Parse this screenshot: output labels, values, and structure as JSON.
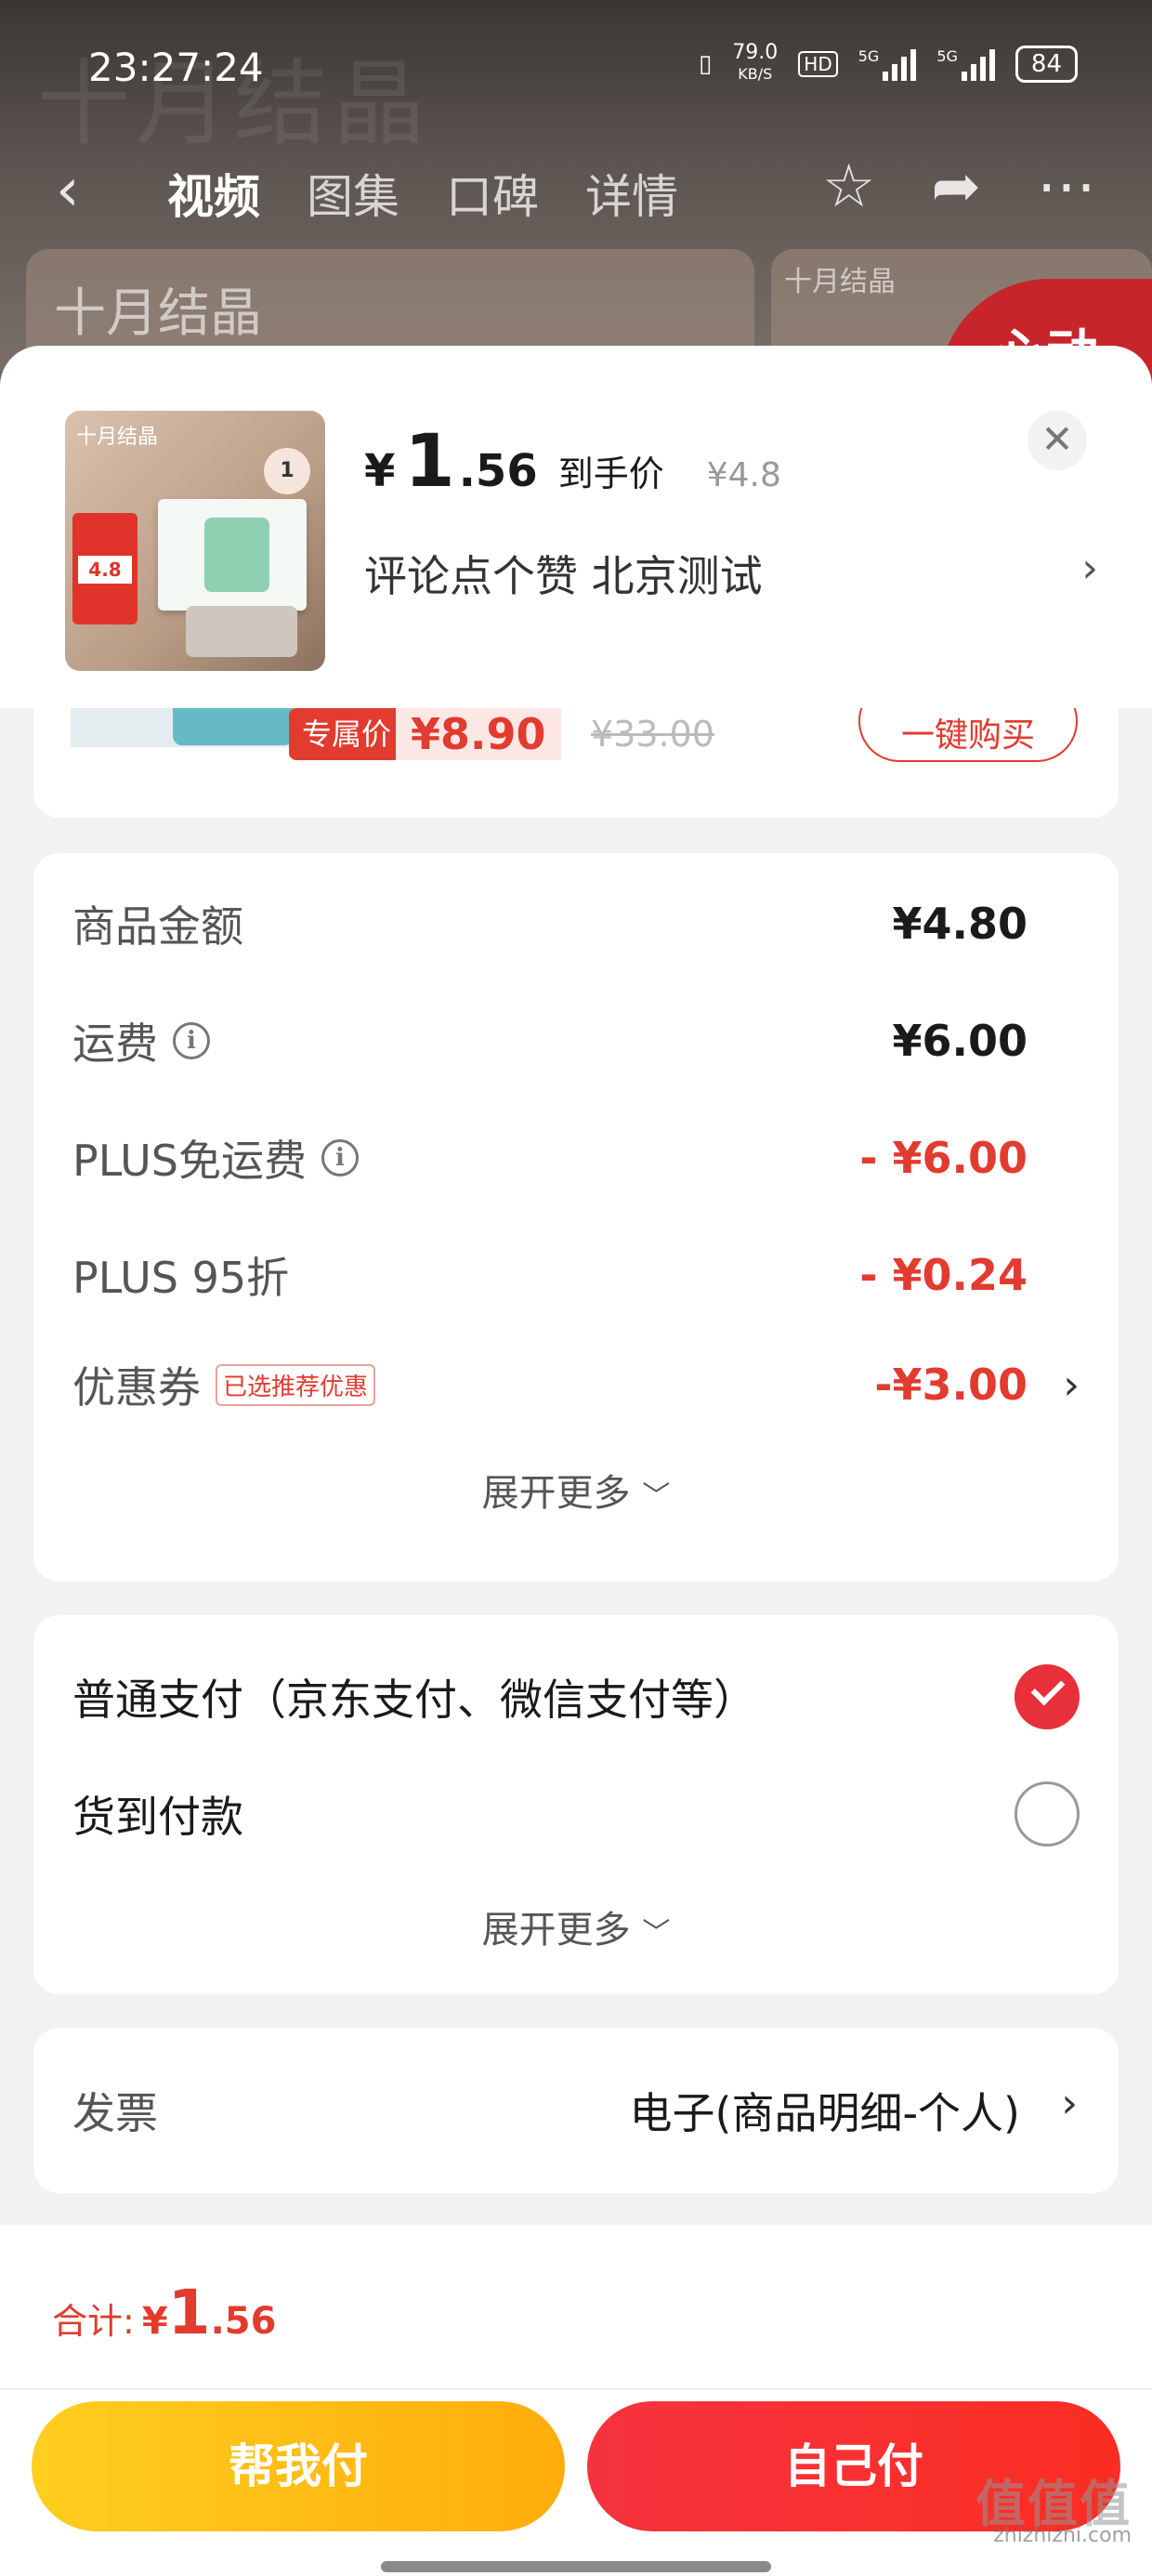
{
  "status_bar": {
    "time": "23:27:24",
    "network_speed": "79.0",
    "network_speed_unit": "KB/S",
    "hd_label": "HD",
    "signal1": "5G",
    "signal2": "5G",
    "battery": "84"
  },
  "background": {
    "brand": "十月结晶",
    "nav_tabs": [
      {
        "label": "视频",
        "active": true
      },
      {
        "label": "图集",
        "active": false
      },
      {
        "label": "口碑",
        "active": false
      },
      {
        "label": "详情",
        "active": false
      }
    ],
    "badge_text": "心动"
  },
  "product": {
    "image_brand": "十月结晶",
    "image_badge": "1",
    "image_price": "4.8",
    "price_symbol": "¥",
    "price_int": "1",
    "price_dec": ".56",
    "price_tag": "到手价",
    "original_price": "¥4.8",
    "spec": "评论点个赞  北京测试",
    "close_icon": "close-icon"
  },
  "recommend_card": {
    "tag": "专属价",
    "price": "¥8.90",
    "original_price": "¥33.00",
    "button_label": "一键购买"
  },
  "cost": {
    "rows": [
      {
        "label": "商品金额",
        "value": "¥4.80",
        "red": false,
        "info": false
      },
      {
        "label": "运费",
        "value": "¥6.00",
        "red": false,
        "info": true
      },
      {
        "label": "PLUS免运费",
        "value": "- ¥6.00",
        "red": true,
        "info": true
      },
      {
        "label": "PLUS 95折",
        "value": "- ¥0.24",
        "red": true,
        "info": false
      }
    ],
    "coupon": {
      "label": "优惠券",
      "badge": "已选推荐优惠",
      "value": "-¥3.00"
    },
    "expand_label": "展开更多"
  },
  "payment": {
    "options": [
      {
        "label": "普通支付（京东支付、微信支付等）",
        "checked": true
      },
      {
        "label": "货到付款",
        "checked": false
      }
    ],
    "expand_label": "展开更多"
  },
  "invoice": {
    "label": "发票",
    "value": "电子(商品明细-个人)"
  },
  "footer": {
    "total_label": "合计:",
    "total_symbol": "¥",
    "total_int": "1",
    "total_dec": ".56",
    "help_pay_label": "帮我付",
    "self_pay_label": "自己付"
  },
  "watermark": {
    "big": "值值值",
    "site": "zhizhizhi.com"
  },
  "colors": {
    "accent_red": "#e23b2f",
    "pay_red": "#f5333f",
    "help_yellow": "#ffbd14",
    "checked_red": "#e8303a"
  }
}
